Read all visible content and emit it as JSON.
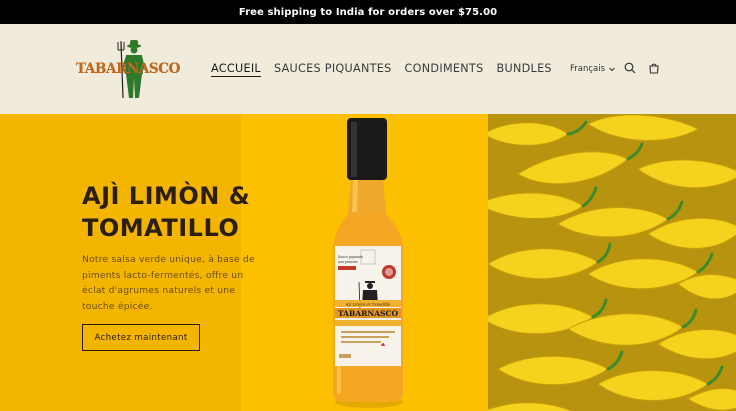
{
  "announcement": {
    "text": "Free shipping to India for orders over $75.00"
  },
  "brand": {
    "name": "TABARNASCO"
  },
  "nav": {
    "items": [
      {
        "label": "ACCUEIL",
        "active": true
      },
      {
        "label": "SAUCES PIQUANTES",
        "active": false
      },
      {
        "label": "CONDIMENTS",
        "active": false
      },
      {
        "label": "BUNDLES",
        "active": false
      }
    ]
  },
  "header": {
    "language": {
      "label": "Français"
    },
    "icons": [
      "search-icon",
      "cart-icon",
      "chevron-down-icon"
    ]
  },
  "hero": {
    "title": "AJÌ LIMÒN & TOMATILLO",
    "description": "Notre salsa verde unique, à base de piments lacto-fermentés, offre un éclat d'agrumes naturels et une touche épicée.",
    "cta_label": "Achetez maintenant",
    "bottle": {
      "brand": "TABARNASCO",
      "label_line": "Ajì Limòn et Tomatillo"
    }
  },
  "colors": {
    "announcement_bg": "#000000",
    "header_bg": "#f0ebdb",
    "hero_left": "#f3b500",
    "hero_mid": "#fcc000",
    "brand_orange": "#c2691c",
    "brand_green": "#2f7a2a"
  }
}
